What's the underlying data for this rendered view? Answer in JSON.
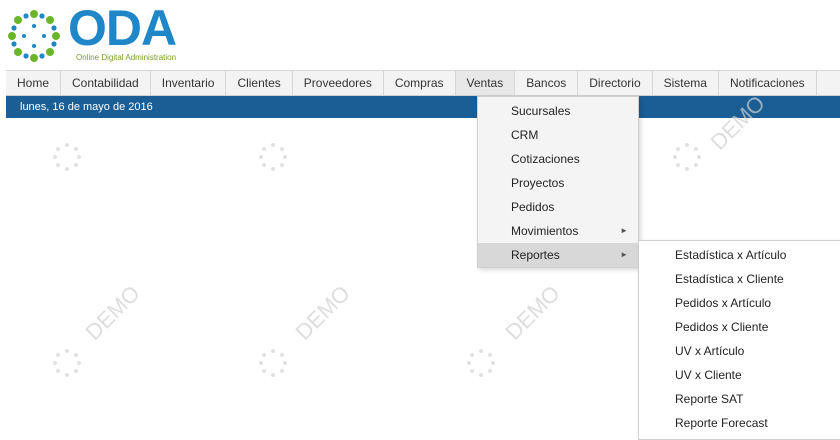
{
  "logo": {
    "name": "ODA",
    "tagline": "Online Digital Administration"
  },
  "nav": [
    "Home",
    "Contabilidad",
    "Inventario",
    "Clientes",
    "Proveedores",
    "Compras",
    "Ventas",
    "Bancos",
    "Directorio",
    "Sistema",
    "Notificaciones"
  ],
  "date_text": "lunes, 16 de mayo de 2016",
  "watermark_text": "DEMO",
  "ventas_menu": [
    "Sucursales",
    "CRM",
    "Cotizaciones",
    "Proyectos",
    "Pedidos",
    "Movimientos",
    "Reportes"
  ],
  "reportes_menu": [
    "Estadística x Artículo",
    "Estadística x Cliente",
    "Pedidos x Artículo",
    "Pedidos x Cliente",
    "UV x Artículo",
    "UV x Cliente",
    "Reporte SAT",
    "Reporte Forecast"
  ],
  "submenu_arrow_icon": "chevron-right-icon",
  "colors": {
    "brand_blue": "#1f86c8",
    "datebar": "#1a5e95",
    "tagline_green": "#7a9e2a"
  }
}
